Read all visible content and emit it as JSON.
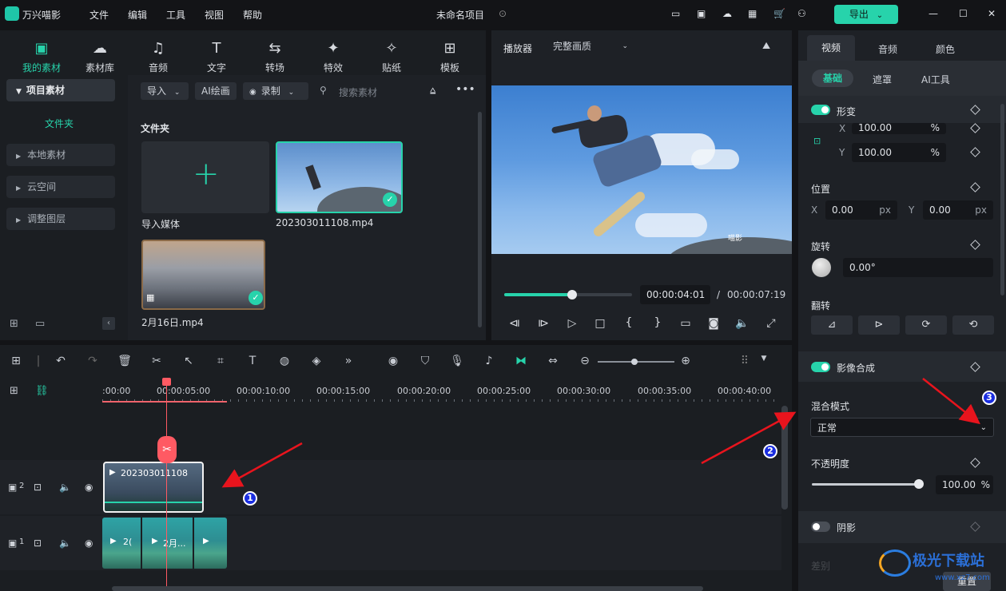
{
  "app": {
    "name": "万兴喵影",
    "project_title": "未命名项目",
    "export_label": "导出"
  },
  "menu": [
    "文件",
    "编辑",
    "工具",
    "视图",
    "帮助"
  ],
  "media_tabs": [
    {
      "label": "我的素材",
      "icon": "media-icon"
    },
    {
      "label": "素材库",
      "icon": "library-icon"
    },
    {
      "label": "音频",
      "icon": "music-icon"
    },
    {
      "label": "文字",
      "icon": "text-icon"
    },
    {
      "label": "转场",
      "icon": "transition-icon"
    },
    {
      "label": "特效",
      "icon": "effects-icon"
    },
    {
      "label": "贴纸",
      "icon": "sticker-icon"
    },
    {
      "label": "模板",
      "icon": "template-icon"
    }
  ],
  "sidebar": {
    "section": "项目素材",
    "folder": "文件夹",
    "items": [
      "本地素材",
      "云空间",
      "调整图层"
    ]
  },
  "media_toolbar": {
    "import": "导入",
    "ai_draw": "AI绘画",
    "record": "录制",
    "search_placeholder": "搜索素材"
  },
  "media": {
    "folder_title": "文件夹",
    "import_label": "导入媒体",
    "clip1": "202303011108.mp4",
    "clip2": "2月16日.mp4"
  },
  "player": {
    "label": "播放器",
    "quality": "完整画质",
    "current_time": "00:00:04:01",
    "separator": "/",
    "total_time": "00:00:07:19",
    "progress": 0.53,
    "watermark": "喵影"
  },
  "timeline": {
    "ticks": [
      ":00:00",
      "00:00:05:00",
      "00:00:10:00",
      "00:00:15:00",
      "00:00:20:00",
      "00:00:25:00",
      "00:00:30:00",
      "00:00:35:00",
      "00:00:40:00"
    ],
    "track2_label": "2",
    "track1_label": "1",
    "clip_top_label": "202303011108",
    "clip_b1": "2(",
    "clip_b2": "2月..."
  },
  "right_panel": {
    "tabs": [
      "视频",
      "音频",
      "颜色"
    ],
    "subtabs": [
      "基础",
      "遮罩",
      "AI工具"
    ],
    "transform": "形变",
    "scale_x_label": "X",
    "scale_x": "100.00",
    "scale_y_label": "Y",
    "scale_y": "100.00",
    "pct": "%",
    "position": "位置",
    "pos_x_label": "X",
    "pos_x": "0.00",
    "pos_y_label": "Y",
    "pos_y": "0.00",
    "px": "px",
    "rotation": "旋转",
    "rotation_val": "0.00°",
    "flip": "翻转",
    "composite": "影像合成",
    "blend_mode": "混合模式",
    "blend_value": "正常",
    "opacity": "不透明度",
    "opacity_val": "100.00",
    "opacity_fraction": 1.0,
    "shadow": "阴影",
    "reset": "重置",
    "faded_label": "差别"
  },
  "annotations": [
    "1",
    "2",
    "3"
  ],
  "watermark": {
    "title": "极光下载站",
    "url": "www.xz7.com"
  },
  "colors": {
    "accent": "#27d3ab",
    "arrow": "#e8141d",
    "badge": "#1b2ee0"
  }
}
